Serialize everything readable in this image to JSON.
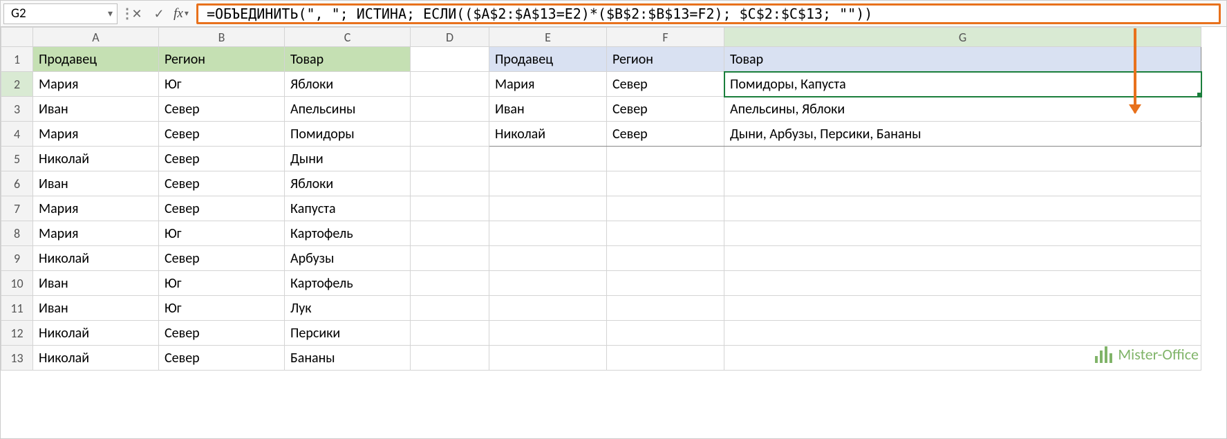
{
  "name_box": "G2",
  "formula": "=ОБЪЕДИНИТЬ(\", \"; ИСТИНА; ЕСЛИ(($A$2:$A$13=E2)*($B$2:$B$13=F2); $C$2:$C$13; \"\"))",
  "columns": [
    "A",
    "B",
    "C",
    "D",
    "E",
    "F",
    "G"
  ],
  "rows": [
    "1",
    "2",
    "3",
    "4",
    "5",
    "6",
    "7",
    "8",
    "9",
    "10",
    "11",
    "12",
    "13"
  ],
  "left_headers": {
    "seller": "Продавец",
    "region": "Регион",
    "product": "Товар"
  },
  "right_headers": {
    "seller": "Продавец",
    "region": "Регион",
    "product": "Товар"
  },
  "left_data": [
    {
      "seller": "Мария",
      "region": "Юг",
      "product": "Яблоки"
    },
    {
      "seller": "Иван",
      "region": "Север",
      "product": "Апельсины"
    },
    {
      "seller": "Мария",
      "region": "Север",
      "product": "Помидоры"
    },
    {
      "seller": "Николай",
      "region": "Север",
      "product": "Дыни"
    },
    {
      "seller": "Иван",
      "region": "Север",
      "product": "Яблоки"
    },
    {
      "seller": "Мария",
      "region": "Север",
      "product": "Капуста"
    },
    {
      "seller": "Мария",
      "region": "Юг",
      "product": "Картофель"
    },
    {
      "seller": "Николай",
      "region": "Север",
      "product": "Арбузы"
    },
    {
      "seller": "Иван",
      "region": "Юг",
      "product": "Картофель"
    },
    {
      "seller": "Иван",
      "region": "Юг",
      "product": "Лук"
    },
    {
      "seller": "Николай",
      "region": "Север",
      "product": "Персики"
    },
    {
      "seller": "Николай",
      "region": "Север",
      "product": "Бананы"
    }
  ],
  "right_data": [
    {
      "seller": "Мария",
      "region": "Север",
      "product": "Помидоры, Капуста"
    },
    {
      "seller": "Иван",
      "region": "Север",
      "product": "Апельсины, Яблоки"
    },
    {
      "seller": "Николай",
      "region": "Север",
      "product": "Дыни, Арбузы, Персики, Бананы"
    }
  ],
  "watermark": "Mister-Office"
}
